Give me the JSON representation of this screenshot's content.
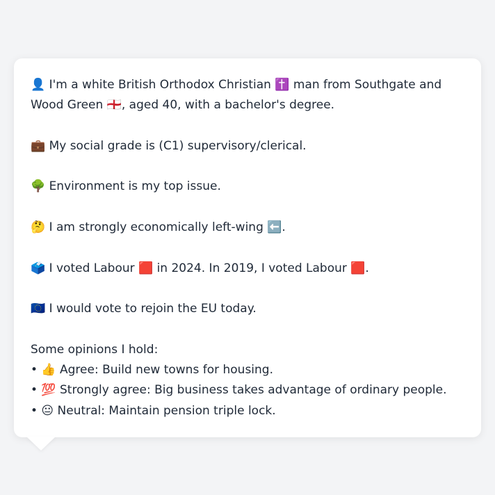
{
  "profile": {
    "identity_line": "👤 I'm a white British Orthodox Christian ✝️ man from Southgate and Wood Green 🏴󠁧󠁢󠁥󠁮󠁧󠁿, aged 40, with a bachelor's degree.",
    "social_grade_line": "💼 My social grade is (C1) supervisory/clerical.",
    "top_issue_line": "🌳 Environment is my top issue.",
    "economic_line": "🤔 I am strongly economically left-wing ⬅️.",
    "vote_line": "🗳️ I voted Labour 🟥 in 2024. In 2019, I voted Labour 🟥.",
    "eu_line": "🇪🇺 I would vote to rejoin the EU today.",
    "opinions_heading": "Some opinions I hold:",
    "opinions": [
      "• 👍 Agree: Build new towns for housing.",
      "• 💯 Strongly agree: Big business takes advantage of ordinary people.",
      "• 😐 Neutral: Maintain pension triple lock."
    ]
  }
}
